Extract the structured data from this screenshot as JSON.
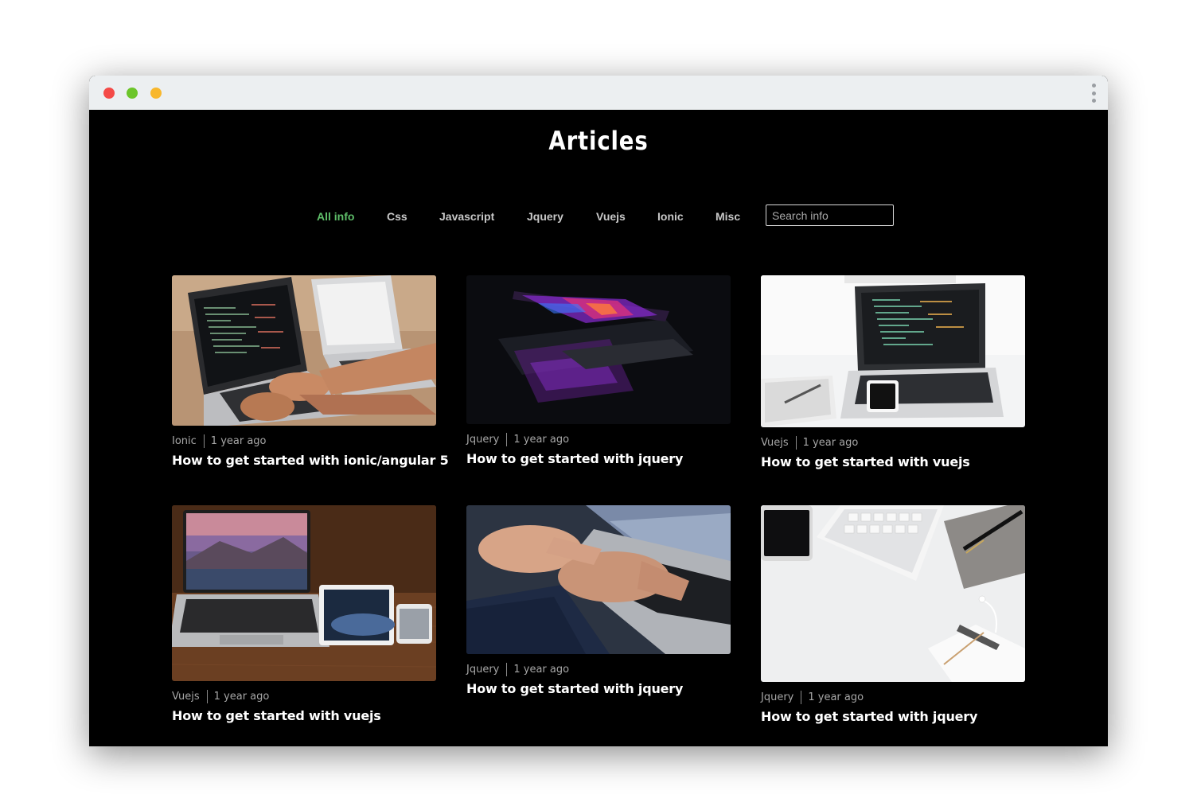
{
  "page": {
    "title": "Articles"
  },
  "filters": {
    "items": [
      {
        "label": "All info",
        "active": true
      },
      {
        "label": "Css",
        "active": false
      },
      {
        "label": "Javascript",
        "active": false
      },
      {
        "label": "Jquery",
        "active": false
      },
      {
        "label": "Vuejs",
        "active": false
      },
      {
        "label": "Ionic",
        "active": false
      },
      {
        "label": "Misc",
        "active": false
      }
    ],
    "search_placeholder": "Search info",
    "active_color": "#5fbf6a"
  },
  "articles": [
    {
      "category": "Ionic",
      "time": "1 year ago",
      "title": "How to get started with ionic/angular 5"
    },
    {
      "category": "Jquery",
      "time": "1 year ago",
      "title": "How to get started with jquery"
    },
    {
      "category": "Vuejs",
      "time": "1 year ago",
      "title": "How to get started with vuejs"
    },
    {
      "category": "Vuejs",
      "time": "1 year ago",
      "title": "How to get started with vuejs"
    },
    {
      "category": "Jquery",
      "time": "1 year ago",
      "title": "How to get started with jquery"
    },
    {
      "category": "Jquery",
      "time": "1 year ago",
      "title": "How to get started with jquery"
    }
  ],
  "icons": {
    "window_controls": [
      "close-icon",
      "minimize-icon",
      "maximize-icon"
    ],
    "menu": "kebab-menu-icon"
  }
}
